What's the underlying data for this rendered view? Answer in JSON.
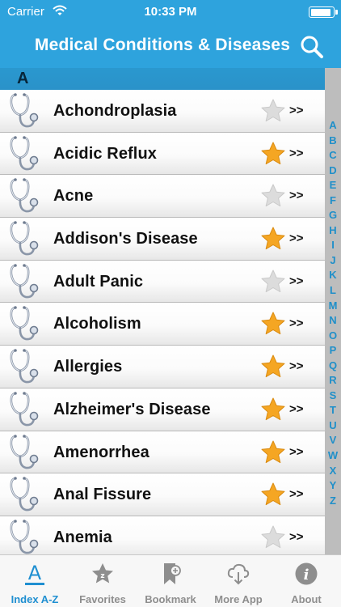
{
  "status": {
    "carrier": "Carrier",
    "time": "10:33 PM"
  },
  "nav": {
    "title": "Medical Conditions & Diseases"
  },
  "section": {
    "letter": "A"
  },
  "rows": [
    {
      "name": "Achondroplasia",
      "favorite": false
    },
    {
      "name": "Acidic Reflux",
      "favorite": true
    },
    {
      "name": "Acne",
      "favorite": false
    },
    {
      "name": "Addison's Disease",
      "favorite": true
    },
    {
      "name": "Adult Panic",
      "favorite": false
    },
    {
      "name": "Alcoholism",
      "favorite": true
    },
    {
      "name": "Allergies",
      "favorite": true
    },
    {
      "name": "Alzheimer's Disease",
      "favorite": true
    },
    {
      "name": "Amenorrhea",
      "favorite": true
    },
    {
      "name": "Anal Fissure",
      "favorite": true
    },
    {
      "name": "Anemia",
      "favorite": false
    }
  ],
  "chevron": ">>",
  "index_letters": [
    "A",
    "B",
    "C",
    "D",
    "E",
    "F",
    "G",
    "H",
    "I",
    "J",
    "K",
    "L",
    "M",
    "N",
    "O",
    "P",
    "Q",
    "R",
    "S",
    "T",
    "U",
    "V",
    "W",
    "X",
    "Y",
    "Z"
  ],
  "tabs": [
    {
      "label": "Index A-Z",
      "icon": "index-az-icon",
      "active": true
    },
    {
      "label": "Favorites",
      "icon": "favorites-star-icon",
      "active": false
    },
    {
      "label": "Bookmark",
      "icon": "bookmark-add-icon",
      "active": false
    },
    {
      "label": "More App",
      "icon": "cloud-download-icon",
      "active": false
    },
    {
      "label": "About",
      "icon": "info-icon",
      "active": false
    }
  ],
  "colors": {
    "accent": "#2ea3dd",
    "star_on": "#f5a623",
    "star_off": "#dcdcdc",
    "tab_active": "#1f8fd1",
    "tab_inactive": "#8e8e8e"
  }
}
